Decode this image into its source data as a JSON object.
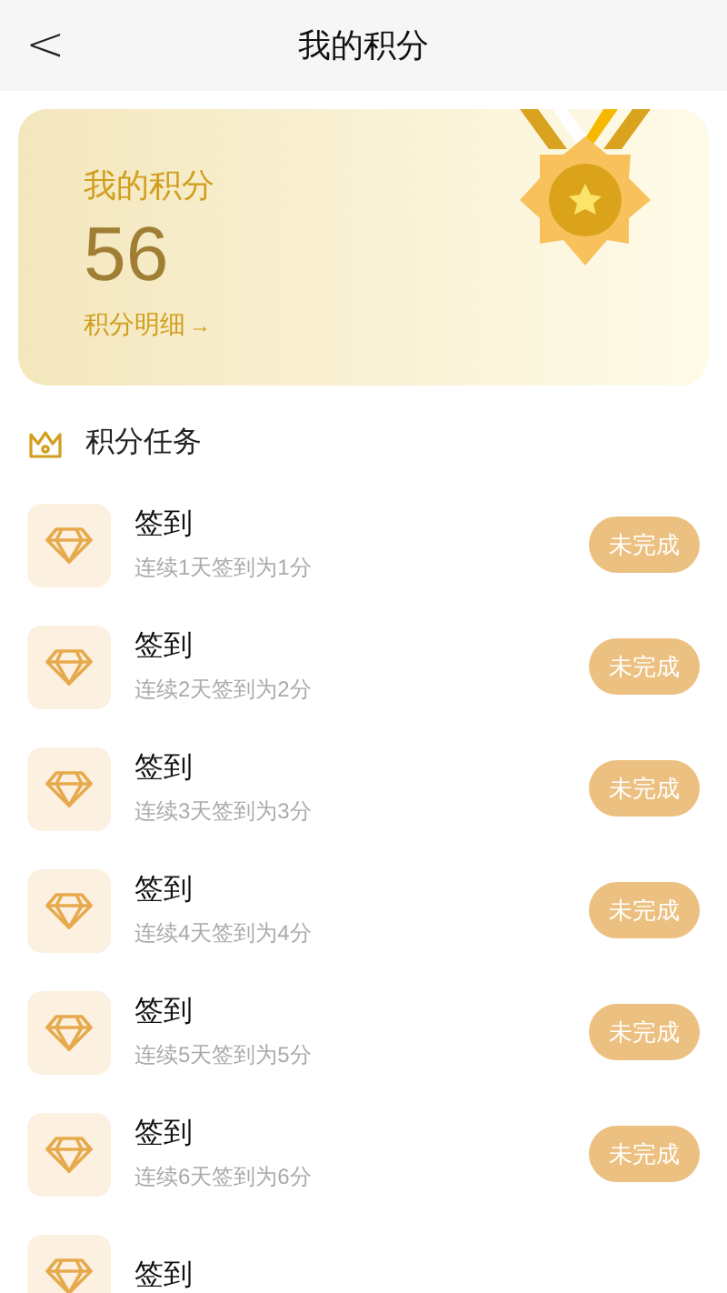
{
  "header": {
    "back": "<",
    "title": "我的积分"
  },
  "points_card": {
    "label": "我的积分",
    "value": "56",
    "link": "积分明细",
    "link_arrow": "→"
  },
  "section": {
    "title": "积分任务"
  },
  "tasks": [
    {
      "title": "签到",
      "desc": "连续1天签到为1分",
      "status": "未完成",
      "done": false
    },
    {
      "title": "签到",
      "desc": "连续2天签到为2分",
      "status": "未完成",
      "done": false
    },
    {
      "title": "签到",
      "desc": "连续3天签到为3分",
      "status": "未完成",
      "done": false
    },
    {
      "title": "签到",
      "desc": "连续4天签到为4分",
      "status": "未完成",
      "done": false
    },
    {
      "title": "签到",
      "desc": "连续5天签到为5分",
      "status": "未完成",
      "done": false
    },
    {
      "title": "签到",
      "desc": "连续6天签到为6分",
      "status": "未完成",
      "done": false
    },
    {
      "title": "签到"
    }
  ]
}
